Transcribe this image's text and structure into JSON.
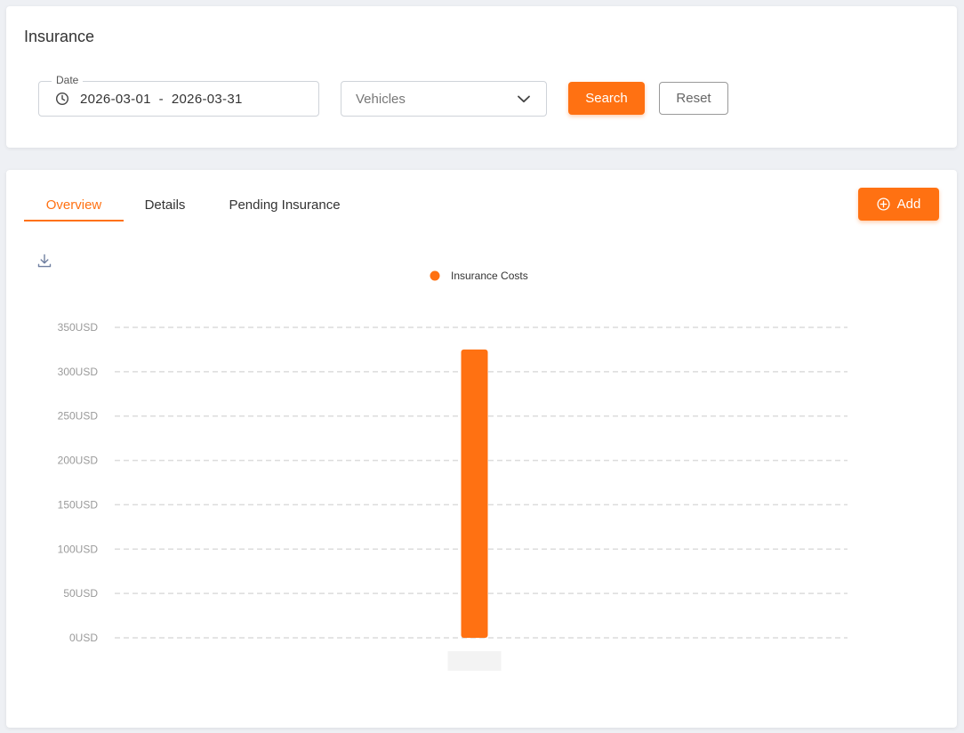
{
  "page": {
    "title": "Insurance"
  },
  "filters": {
    "date_label": "Date",
    "date_range": "2026-03-01  -  2026-03-31",
    "vehicle_placeholder": "Vehicles",
    "search_label": "Search",
    "reset_label": "Reset"
  },
  "tabs": [
    {
      "label": "Overview",
      "active": true
    },
    {
      "label": "Details",
      "active": false
    },
    {
      "label": "Pending Insurance",
      "active": false
    }
  ],
  "actions": {
    "add_label": "Add"
  },
  "icons": {
    "date": "clock-icon",
    "select": "chevron-down-icon",
    "add": "plus-circle-icon",
    "export": "download-icon"
  },
  "colors": {
    "accent": "#ff7112",
    "grid": "#dcdcdc",
    "tick_label": "#9a9a9a"
  },
  "chart_data": {
    "type": "bar",
    "legend_position": "top-center",
    "grid": true,
    "categories": [
      ""
    ],
    "series": [
      {
        "name": "Insurance Costs",
        "values": [
          325
        ],
        "color": "#ff7112"
      }
    ],
    "ylim": [
      0,
      350
    ],
    "yticks": [
      "0USD",
      "50USD",
      "100USD",
      "150USD",
      "200USD",
      "250USD",
      "300USD",
      "350USD"
    ]
  }
}
